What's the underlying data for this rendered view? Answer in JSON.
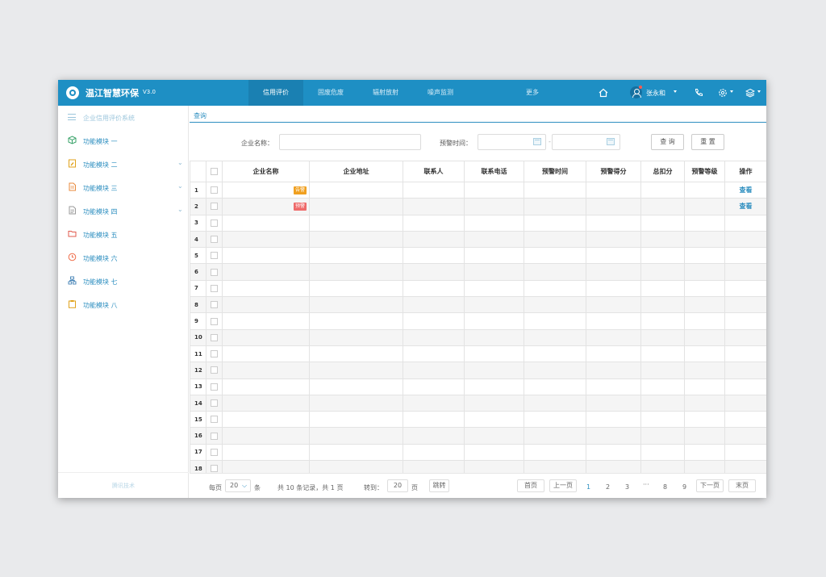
{
  "header": {
    "app_title": "温江智慧环保",
    "version": "V3.0",
    "tabs": [
      "信用评价",
      "固废危废",
      "辐射放射",
      "噪声监测",
      "更多"
    ],
    "active_tab": "信用评价",
    "user_name": "张永和"
  },
  "sidebar": {
    "title": "企业信用评价系统",
    "items": [
      {
        "label": "功能模块 一",
        "icon": "cube-icon",
        "color": "#3aa36a",
        "expandable": false
      },
      {
        "label": "功能模块 二",
        "icon": "document-edit-icon",
        "color": "#e0a21b",
        "expandable": true
      },
      {
        "label": "功能模块 三",
        "icon": "document-icon",
        "color": "#e8893b",
        "expandable": true
      },
      {
        "label": "功能模块 四",
        "icon": "file-list-icon",
        "color": "#9a9a9a",
        "expandable": true
      },
      {
        "label": "功能模块 五",
        "icon": "folder-icon",
        "color": "#e05a4e",
        "expandable": false
      },
      {
        "label": "功能模块 六",
        "icon": "clock-icon",
        "color": "#ef6d4a",
        "expandable": false
      },
      {
        "label": "功能模块 七",
        "icon": "sitemap-icon",
        "color": "#3f7fb4",
        "expandable": false
      },
      {
        "label": "功能模块 八",
        "icon": "clipboard-icon",
        "color": "#e0a21b",
        "expandable": false
      }
    ],
    "footer": "腾讯技术"
  },
  "breadcrumb": "查询",
  "query": {
    "company_label": "企业名称：",
    "company_value": "",
    "time_label": "预警时间：",
    "start_value": "",
    "end_value": "",
    "search_btn": "查 询",
    "reset_btn": "重 置"
  },
  "table": {
    "columns": [
      "企业名称",
      "企业地址",
      "联系人",
      "联系电话",
      "预警时间",
      "预警得分",
      "总扣分",
      "预警等级",
      "操作"
    ],
    "rows": [
      {
        "idx": "1",
        "badge": "告警",
        "badge_color": "#f0a020",
        "action": "查看"
      },
      {
        "idx": "2",
        "badge": "预警",
        "badge_color": "#ee6a6a",
        "action": "查看"
      },
      {
        "idx": "3"
      },
      {
        "idx": "4"
      },
      {
        "idx": "5"
      },
      {
        "idx": "6"
      },
      {
        "idx": "7"
      },
      {
        "idx": "8"
      },
      {
        "idx": "9"
      },
      {
        "idx": "10"
      },
      {
        "idx": "11"
      },
      {
        "idx": "12"
      },
      {
        "idx": "13"
      },
      {
        "idx": "14"
      },
      {
        "idx": "15"
      },
      {
        "idx": "16"
      },
      {
        "idx": "17"
      },
      {
        "idx": "18"
      }
    ]
  },
  "pager": {
    "per_page_label": "每页",
    "per_page_value": "20",
    "per_page_unit": "条",
    "summary": "共 10 条记录，共 1 页",
    "goto_label": "转到：",
    "goto_value": "20",
    "goto_unit": "页",
    "goto_btn": "跳转",
    "first": "首页",
    "prev": "上一页",
    "pages": [
      "1",
      "2",
      "3",
      "···",
      "8",
      "9"
    ],
    "current_page": "1",
    "next": "下一页",
    "last": "末页"
  }
}
